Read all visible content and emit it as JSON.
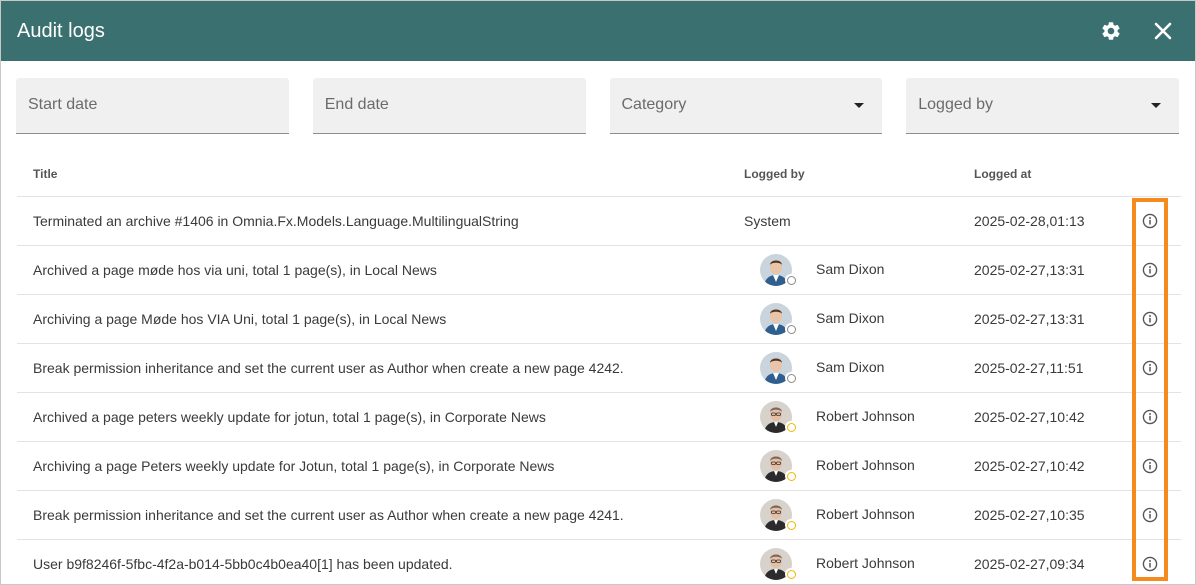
{
  "header": {
    "title": "Audit logs",
    "settings_icon": "gear-icon",
    "close_icon": "close-icon"
  },
  "filters": {
    "start_date": "Start date",
    "end_date": "End date",
    "category": "Category",
    "logged_by": "Logged by"
  },
  "columns": {
    "title": "Title",
    "logged_by": "Logged by",
    "logged_at": "Logged at"
  },
  "rows": [
    {
      "title": "Terminated an archive #1406 in Omnia.Fx.Models.Language.MultilingualString",
      "logged_by": "System",
      "logged_at": "2025-02-28,01:13"
    },
    {
      "title": "Archived a page møde hos via uni, total 1 page(s), in Local News",
      "logged_by": "Sam Dixon",
      "logged_at": "2025-02-27,13:31"
    },
    {
      "title": "Archiving a page Møde hos VIA Uni, total 1 page(s), in Local News",
      "logged_by": "Sam Dixon",
      "logged_at": "2025-02-27,13:31"
    },
    {
      "title": "Break permission inheritance and set the current user as Author when create a new page 4242.",
      "logged_by": "Sam Dixon",
      "logged_at": "2025-02-27,11:51"
    },
    {
      "title": "Archived a page peters weekly update for jotun, total 1 page(s), in Corporate News",
      "logged_by": "Robert Johnson",
      "logged_at": "2025-02-27,10:42"
    },
    {
      "title": "Archiving a page Peters weekly update for Jotun, total 1 page(s), in Corporate News",
      "logged_by": "Robert Johnson",
      "logged_at": "2025-02-27,10:42"
    },
    {
      "title": "Break permission inheritance and set the current user as Author when create a new page 4241.",
      "logged_by": "Robert Johnson",
      "logged_at": "2025-02-27,10:35"
    },
    {
      "title": "User b9f8246f-5fbc-4f2a-b014-5bb0c4b0ea40[1] has been updated.",
      "logged_by": "Robert Johnson",
      "logged_at": "2025-02-27,09:34"
    }
  ],
  "colors": {
    "header_bg": "#3b7070",
    "highlight": "#f58a1f",
    "status_offline": "#8a8a8a",
    "status_away": "#f2b600"
  }
}
